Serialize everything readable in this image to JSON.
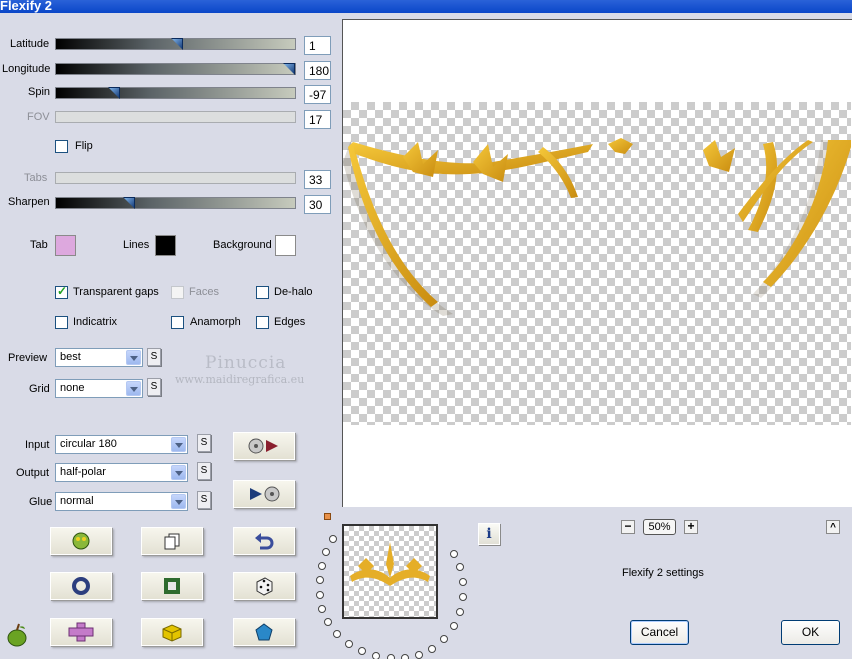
{
  "window": {
    "title": "Flexify 2"
  },
  "sliders": {
    "latitude": {
      "label": "Latitude",
      "value": "1"
    },
    "longitude": {
      "label": "Longitude",
      "value": "180"
    },
    "spin": {
      "label": "Spin",
      "value": "-97"
    },
    "fov": {
      "label": "FOV",
      "value": "17"
    },
    "tabs": {
      "label": "Tabs",
      "value": "33"
    },
    "sharpen": {
      "label": "Sharpen",
      "value": "30"
    }
  },
  "flip": {
    "label": "Flip",
    "checked": false
  },
  "colors": {
    "tab": {
      "label": "Tab",
      "color": "#dda8de"
    },
    "lines": {
      "label": "Lines",
      "color": "#000000"
    },
    "background": {
      "label": "Background",
      "color": "#ffffff"
    }
  },
  "options": {
    "transparent_gaps": {
      "label": "Transparent gaps",
      "checked": true
    },
    "faces": {
      "label": "Faces",
      "checked": false
    },
    "de_halo": {
      "label": "De-halo",
      "checked": false
    },
    "indicatrix": {
      "label": "Indicatrix",
      "checked": false
    },
    "anamorph": {
      "label": "Anamorph",
      "checked": false
    },
    "edges": {
      "label": "Edges",
      "checked": false
    }
  },
  "preview_select": {
    "label": "Preview",
    "value": "best"
  },
  "grid_select": {
    "label": "Grid",
    "value": "none"
  },
  "input_select": {
    "label": "Input",
    "value": "circular 180"
  },
  "output_select": {
    "label": "Output",
    "value": "half-polar"
  },
  "glue_select": {
    "label": "Glue",
    "value": "normal"
  },
  "s_button_label": "S",
  "watermark": {
    "name": "Pinuccia",
    "url": "www.maidiregrafica.eu"
  },
  "zoom": {
    "minus": "−",
    "value": "50%",
    "plus": "+"
  },
  "settings_caption": "Flexify 2 settings",
  "collapse_label": "^",
  "info_label": "i",
  "buttons": {
    "cancel": "Cancel",
    "ok": "OK"
  },
  "accent_colors": {
    "gold": "#e8b21c",
    "title_bar": "#0a46c8"
  }
}
